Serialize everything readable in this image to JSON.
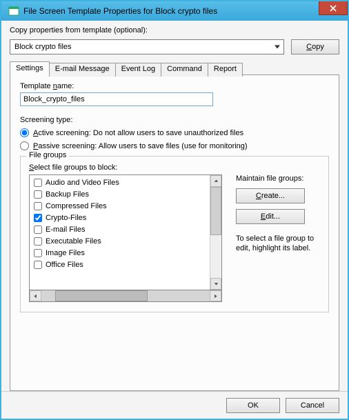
{
  "title": "File Screen Template Properties for Block crypto files",
  "copy_section": {
    "label": "Copy properties from template (optional):",
    "selected": "Block crypto files",
    "copy_button": "Copy"
  },
  "tabs": [
    "Settings",
    "E-mail Message",
    "Event Log",
    "Command",
    "Report"
  ],
  "active_tab": 0,
  "settings": {
    "template_name_label": "Template name:",
    "template_name_value": "Block_crypto_files",
    "screening_type_label": "Screening type:",
    "active_option": "Active screening: Do not allow users to save unauthorized files",
    "passive_option": "Passive screening: Allow users to save files (use for monitoring)",
    "screening_selected": "active",
    "file_groups": {
      "legend": "File groups",
      "select_label": "Select file groups to block:",
      "items": [
        {
          "label": "Audio and Video Files",
          "checked": false
        },
        {
          "label": "Backup Files",
          "checked": false
        },
        {
          "label": "Compressed Files",
          "checked": false
        },
        {
          "label": "Crypto-Files",
          "checked": true
        },
        {
          "label": "E-mail Files",
          "checked": false
        },
        {
          "label": "Executable Files",
          "checked": false
        },
        {
          "label": "Image Files",
          "checked": false
        },
        {
          "label": "Office Files",
          "checked": false
        }
      ],
      "maintain_label": "Maintain file groups:",
      "create_button": "Create...",
      "edit_button": "Edit...",
      "hint": "To select a file group to edit, highlight its label."
    }
  },
  "dialog_buttons": {
    "ok": "OK",
    "cancel": "Cancel"
  }
}
